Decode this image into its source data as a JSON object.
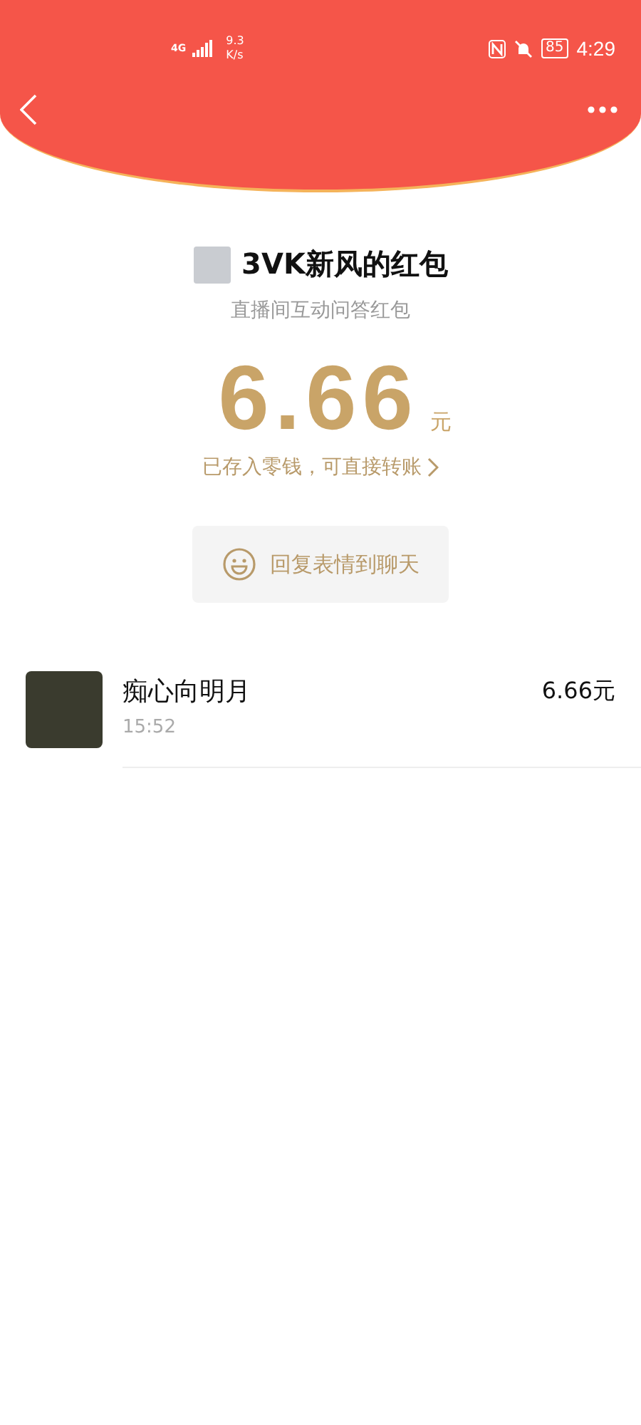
{
  "status_bar": {
    "network": "4G",
    "speed_value": "9.3",
    "speed_unit": "K/s",
    "battery": "85",
    "time": "4:29"
  },
  "envelope": {
    "title": "3VK新风的红包",
    "subtitle": "直播间互动问答红包",
    "amount": "6.66",
    "currency": "元",
    "note": "已存入零钱，可直接转账",
    "reply_button": "回复表情到聊天"
  },
  "receivers": [
    {
      "name": "痴心向明月",
      "time": "15:52",
      "amount": "6.66元"
    }
  ]
}
